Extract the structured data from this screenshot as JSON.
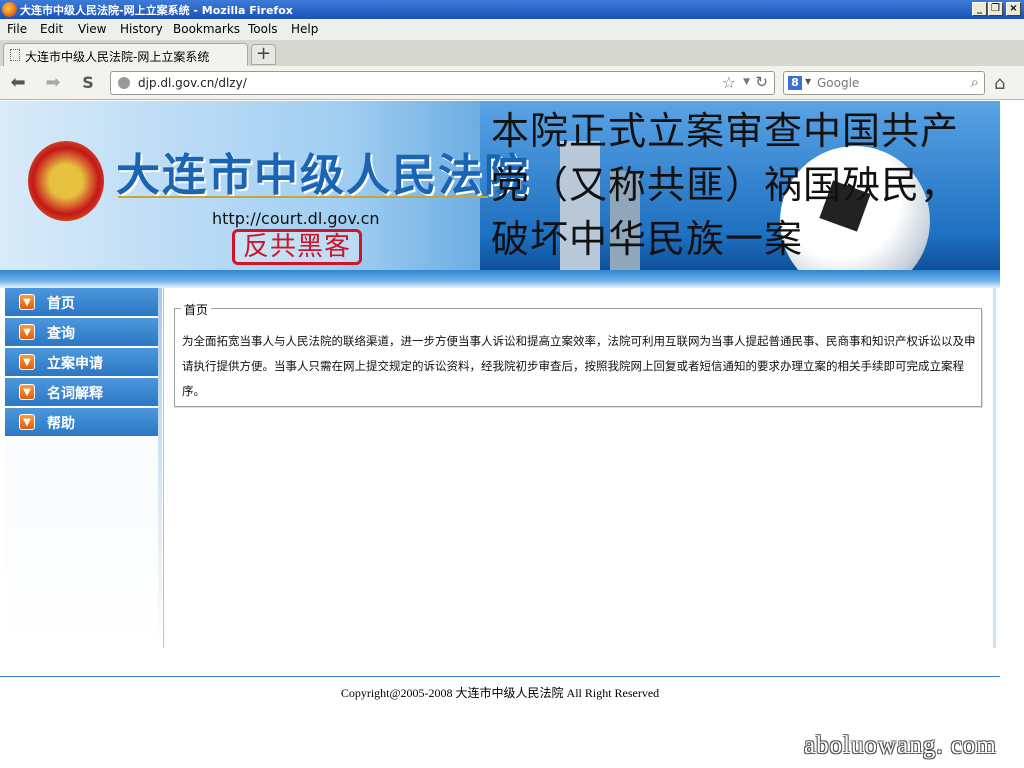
{
  "window": {
    "title": "大连市中级人民法院-网上立案系统 - Mozilla Firefox",
    "controls": {
      "minimize": "_",
      "restore": "❐",
      "close": "×"
    }
  },
  "menu": [
    "File",
    "Edit",
    "View",
    "History",
    "Bookmarks",
    "Tools",
    "Help"
  ],
  "tab": {
    "label": "大连市中级人民法院-网上立案系统",
    "new_tab": "+"
  },
  "nav": {
    "url": "djp.dl.gov.cn/dlzy/",
    "search_placeholder": "Google",
    "search_engine_glyph": "8"
  },
  "banner": {
    "court_name": "大连市中级人民法院",
    "site_url": "http://court.dl.gov.cn",
    "stamp": "反共黑客",
    "overlay": "本院正式立案审查中国共产党（又称共匪）祸国殃民，破坏中华民族一案"
  },
  "sidebar": {
    "items": [
      {
        "label": "首页"
      },
      {
        "label": "查询"
      },
      {
        "label": "立案申请"
      },
      {
        "label": "名词解释"
      },
      {
        "label": "帮助"
      }
    ]
  },
  "content": {
    "legend": "首页",
    "text": "为全面拓宽当事人与人民法院的联络渠道，进一步方便当事人诉讼和提高立案效率，法院可利用互联网为当事人提起普通民事、民商事和知识产权诉讼以及申请执行提供方便。当事人只需在网上提交规定的诉讼资料，经我院初步审查后，按照我院网上回复或者短信通知的要求办理立案的相关手续即可完成立案程序。"
  },
  "footer": {
    "copyright": "Copyright@2005-2008 大连市中级人民法院 All Right Reserved"
  },
  "watermark": "aboluowang. com",
  "colors": {
    "accent": "#2c77c4",
    "nav_arrow": "#e25d0c",
    "stamp": "#d0142a",
    "titlebar": "#1b52b8"
  }
}
